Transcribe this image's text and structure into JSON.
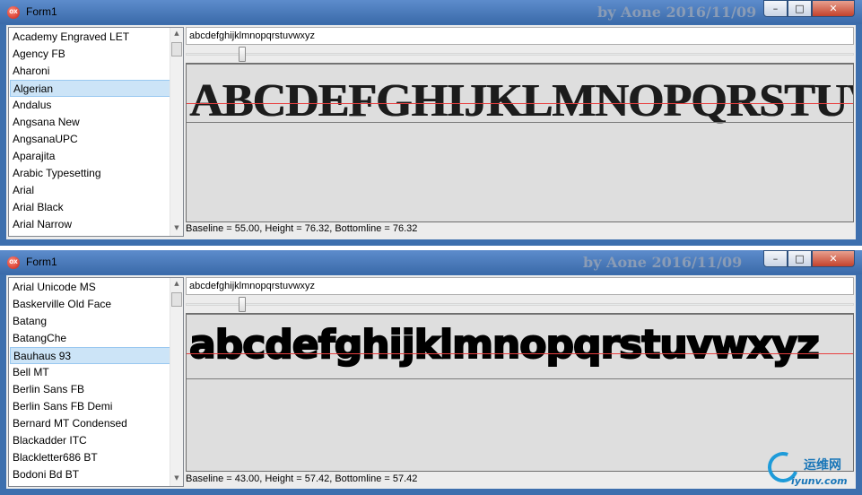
{
  "windows": [
    {
      "title": "Form1",
      "app_icon_text": "OX",
      "watermark": "by Aone 2016/11/09",
      "controls": {
        "minimize": "–",
        "maximize": "□",
        "close": "✕"
      },
      "font_list": [
        "Academy Engraved LET",
        "Agency FB",
        "Aharoni",
        "Algerian",
        "Andalus",
        "Angsana New",
        "AngsanaUPC",
        "Aparajita",
        "Arabic Typesetting",
        "Arial",
        "Arial Black",
        "Arial Narrow"
      ],
      "selected_index": 3,
      "sample_input": "abcdefghijklmnopqrstuvwxyz",
      "rendered_sample": "ABCDEFGHIJKLMNOPQRSTUVWXYZ",
      "status": "Baseline = 55.00, Height = 76.32, Bottomline = 76.32"
    },
    {
      "title": "Form1",
      "app_icon_text": "OX",
      "watermark": "by Aone 2016/11/09",
      "controls": {
        "minimize": "–",
        "maximize": "□",
        "close": "✕"
      },
      "font_list": [
        "Arial Unicode MS",
        "Baskerville Old Face",
        "Batang",
        "BatangChe",
        "Bauhaus 93",
        "Bell MT",
        "Berlin Sans FB",
        "Berlin Sans FB Demi",
        "Bernard MT Condensed",
        "Blackadder ITC",
        "Blackletter686 BT",
        "Bodoni Bd BT"
      ],
      "selected_index": 4,
      "sample_input": "abcdefghijklmnopqrstuvwxyz",
      "rendered_sample": "abcdefghijklmnopqrstuvwxyz",
      "status": "Baseline = 43.00, Height = 57.42, Bottomline = 57.42"
    }
  ],
  "logo": {
    "chinese": "运维网",
    "domain": "iyunv.com"
  },
  "colors": {
    "baseline": "#e84040",
    "selection": "#cce4f7",
    "titlebar": "#3d6fae"
  }
}
